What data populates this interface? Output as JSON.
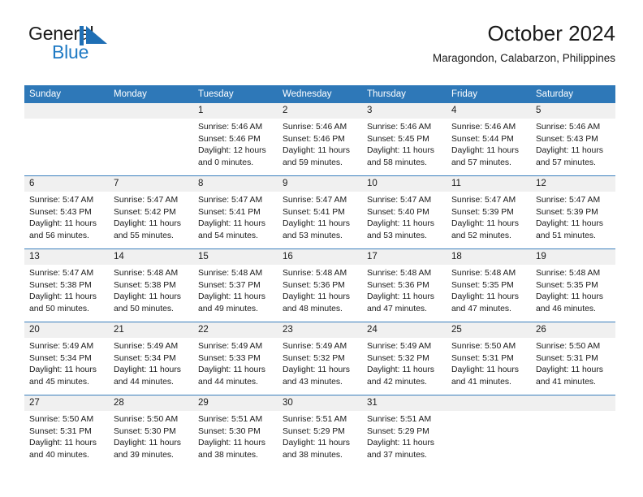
{
  "brand": {
    "name_primary": "General",
    "name_secondary": "Blue",
    "mark": "sail-triangle-logo",
    "accent_color": "#1f7ac4"
  },
  "header": {
    "title": "October 2024",
    "subtitle": "Maragondon, Calabarzon, Philippines"
  },
  "theme": {
    "header_bar_color": "#2e78b8",
    "day_band_color": "#f0f0f0",
    "row_divider_color": "#3a7fbd"
  },
  "weekdays": [
    "Sunday",
    "Monday",
    "Tuesday",
    "Wednesday",
    "Thursday",
    "Friday",
    "Saturday"
  ],
  "weeks": [
    [
      {
        "day": "",
        "empty": true
      },
      {
        "day": "",
        "empty": true
      },
      {
        "day": "1",
        "sunrise": "Sunrise: 5:46 AM",
        "sunset": "Sunset: 5:46 PM",
        "daylight1": "Daylight: 12 hours",
        "daylight2": "and 0 minutes."
      },
      {
        "day": "2",
        "sunrise": "Sunrise: 5:46 AM",
        "sunset": "Sunset: 5:46 PM",
        "daylight1": "Daylight: 11 hours",
        "daylight2": "and 59 minutes."
      },
      {
        "day": "3",
        "sunrise": "Sunrise: 5:46 AM",
        "sunset": "Sunset: 5:45 PM",
        "daylight1": "Daylight: 11 hours",
        "daylight2": "and 58 minutes."
      },
      {
        "day": "4",
        "sunrise": "Sunrise: 5:46 AM",
        "sunset": "Sunset: 5:44 PM",
        "daylight1": "Daylight: 11 hours",
        "daylight2": "and 57 minutes."
      },
      {
        "day": "5",
        "sunrise": "Sunrise: 5:46 AM",
        "sunset": "Sunset: 5:43 PM",
        "daylight1": "Daylight: 11 hours",
        "daylight2": "and 57 minutes."
      }
    ],
    [
      {
        "day": "6",
        "sunrise": "Sunrise: 5:47 AM",
        "sunset": "Sunset: 5:43 PM",
        "daylight1": "Daylight: 11 hours",
        "daylight2": "and 56 minutes."
      },
      {
        "day": "7",
        "sunrise": "Sunrise: 5:47 AM",
        "sunset": "Sunset: 5:42 PM",
        "daylight1": "Daylight: 11 hours",
        "daylight2": "and 55 minutes."
      },
      {
        "day": "8",
        "sunrise": "Sunrise: 5:47 AM",
        "sunset": "Sunset: 5:41 PM",
        "daylight1": "Daylight: 11 hours",
        "daylight2": "and 54 minutes."
      },
      {
        "day": "9",
        "sunrise": "Sunrise: 5:47 AM",
        "sunset": "Sunset: 5:41 PM",
        "daylight1": "Daylight: 11 hours",
        "daylight2": "and 53 minutes."
      },
      {
        "day": "10",
        "sunrise": "Sunrise: 5:47 AM",
        "sunset": "Sunset: 5:40 PM",
        "daylight1": "Daylight: 11 hours",
        "daylight2": "and 53 minutes."
      },
      {
        "day": "11",
        "sunrise": "Sunrise: 5:47 AM",
        "sunset": "Sunset: 5:39 PM",
        "daylight1": "Daylight: 11 hours",
        "daylight2": "and 52 minutes."
      },
      {
        "day": "12",
        "sunrise": "Sunrise: 5:47 AM",
        "sunset": "Sunset: 5:39 PM",
        "daylight1": "Daylight: 11 hours",
        "daylight2": "and 51 minutes."
      }
    ],
    [
      {
        "day": "13",
        "sunrise": "Sunrise: 5:47 AM",
        "sunset": "Sunset: 5:38 PM",
        "daylight1": "Daylight: 11 hours",
        "daylight2": "and 50 minutes."
      },
      {
        "day": "14",
        "sunrise": "Sunrise: 5:48 AM",
        "sunset": "Sunset: 5:38 PM",
        "daylight1": "Daylight: 11 hours",
        "daylight2": "and 50 minutes."
      },
      {
        "day": "15",
        "sunrise": "Sunrise: 5:48 AM",
        "sunset": "Sunset: 5:37 PM",
        "daylight1": "Daylight: 11 hours",
        "daylight2": "and 49 minutes."
      },
      {
        "day": "16",
        "sunrise": "Sunrise: 5:48 AM",
        "sunset": "Sunset: 5:36 PM",
        "daylight1": "Daylight: 11 hours",
        "daylight2": "and 48 minutes."
      },
      {
        "day": "17",
        "sunrise": "Sunrise: 5:48 AM",
        "sunset": "Sunset: 5:36 PM",
        "daylight1": "Daylight: 11 hours",
        "daylight2": "and 47 minutes."
      },
      {
        "day": "18",
        "sunrise": "Sunrise: 5:48 AM",
        "sunset": "Sunset: 5:35 PM",
        "daylight1": "Daylight: 11 hours",
        "daylight2": "and 47 minutes."
      },
      {
        "day": "19",
        "sunrise": "Sunrise: 5:48 AM",
        "sunset": "Sunset: 5:35 PM",
        "daylight1": "Daylight: 11 hours",
        "daylight2": "and 46 minutes."
      }
    ],
    [
      {
        "day": "20",
        "sunrise": "Sunrise: 5:49 AM",
        "sunset": "Sunset: 5:34 PM",
        "daylight1": "Daylight: 11 hours",
        "daylight2": "and 45 minutes."
      },
      {
        "day": "21",
        "sunrise": "Sunrise: 5:49 AM",
        "sunset": "Sunset: 5:34 PM",
        "daylight1": "Daylight: 11 hours",
        "daylight2": "and 44 minutes."
      },
      {
        "day": "22",
        "sunrise": "Sunrise: 5:49 AM",
        "sunset": "Sunset: 5:33 PM",
        "daylight1": "Daylight: 11 hours",
        "daylight2": "and 44 minutes."
      },
      {
        "day": "23",
        "sunrise": "Sunrise: 5:49 AM",
        "sunset": "Sunset: 5:32 PM",
        "daylight1": "Daylight: 11 hours",
        "daylight2": "and 43 minutes."
      },
      {
        "day": "24",
        "sunrise": "Sunrise: 5:49 AM",
        "sunset": "Sunset: 5:32 PM",
        "daylight1": "Daylight: 11 hours",
        "daylight2": "and 42 minutes."
      },
      {
        "day": "25",
        "sunrise": "Sunrise: 5:50 AM",
        "sunset": "Sunset: 5:31 PM",
        "daylight1": "Daylight: 11 hours",
        "daylight2": "and 41 minutes."
      },
      {
        "day": "26",
        "sunrise": "Sunrise: 5:50 AM",
        "sunset": "Sunset: 5:31 PM",
        "daylight1": "Daylight: 11 hours",
        "daylight2": "and 41 minutes."
      }
    ],
    [
      {
        "day": "27",
        "sunrise": "Sunrise: 5:50 AM",
        "sunset": "Sunset: 5:31 PM",
        "daylight1": "Daylight: 11 hours",
        "daylight2": "and 40 minutes."
      },
      {
        "day": "28",
        "sunrise": "Sunrise: 5:50 AM",
        "sunset": "Sunset: 5:30 PM",
        "daylight1": "Daylight: 11 hours",
        "daylight2": "and 39 minutes."
      },
      {
        "day": "29",
        "sunrise": "Sunrise: 5:51 AM",
        "sunset": "Sunset: 5:30 PM",
        "daylight1": "Daylight: 11 hours",
        "daylight2": "and 38 minutes."
      },
      {
        "day": "30",
        "sunrise": "Sunrise: 5:51 AM",
        "sunset": "Sunset: 5:29 PM",
        "daylight1": "Daylight: 11 hours",
        "daylight2": "and 38 minutes."
      },
      {
        "day": "31",
        "sunrise": "Sunrise: 5:51 AM",
        "sunset": "Sunset: 5:29 PM",
        "daylight1": "Daylight: 11 hours",
        "daylight2": "and 37 minutes."
      },
      {
        "day": "",
        "empty": true
      },
      {
        "day": "",
        "empty": true
      }
    ]
  ]
}
